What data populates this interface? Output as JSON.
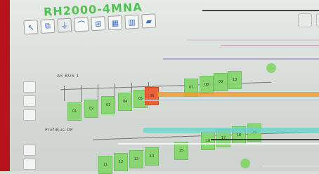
{
  "window": {
    "title": "RH2000-4MNA"
  },
  "toolbar": {
    "buttons": [
      {
        "name": "arrow-icon",
        "glyph": "↖"
      },
      {
        "name": "copy-icon",
        "glyph": "⧉"
      },
      {
        "name": "connector-icon",
        "glyph": "⏚"
      },
      {
        "name": "bus-icon",
        "glyph": "⌒"
      },
      {
        "name": "network-icon",
        "glyph": "⊞"
      },
      {
        "name": "grid-icon",
        "glyph": "▦"
      },
      {
        "name": "grid2-icon",
        "glyph": "▥"
      },
      {
        "name": "folder-icon",
        "glyph": "▰"
      }
    ]
  },
  "diagram": {
    "bus1_label": "AS BUS 1",
    "left_label": "ProfiBus DP",
    "devices_top": [
      "01",
      "02",
      "03",
      "04",
      "05",
      "06"
    ],
    "devices_mid": [
      "07",
      "08",
      "09",
      "10"
    ],
    "devices_low": [
      "11",
      "12",
      "13",
      "14",
      "15"
    ],
    "devices_right": [
      "16",
      "17",
      "18",
      "19"
    ]
  },
  "colors": {
    "accent_red": "#b5141c",
    "device_ok": "#86d66d",
    "device_fault": "#f05a2d",
    "title_green": "#49c04d"
  }
}
